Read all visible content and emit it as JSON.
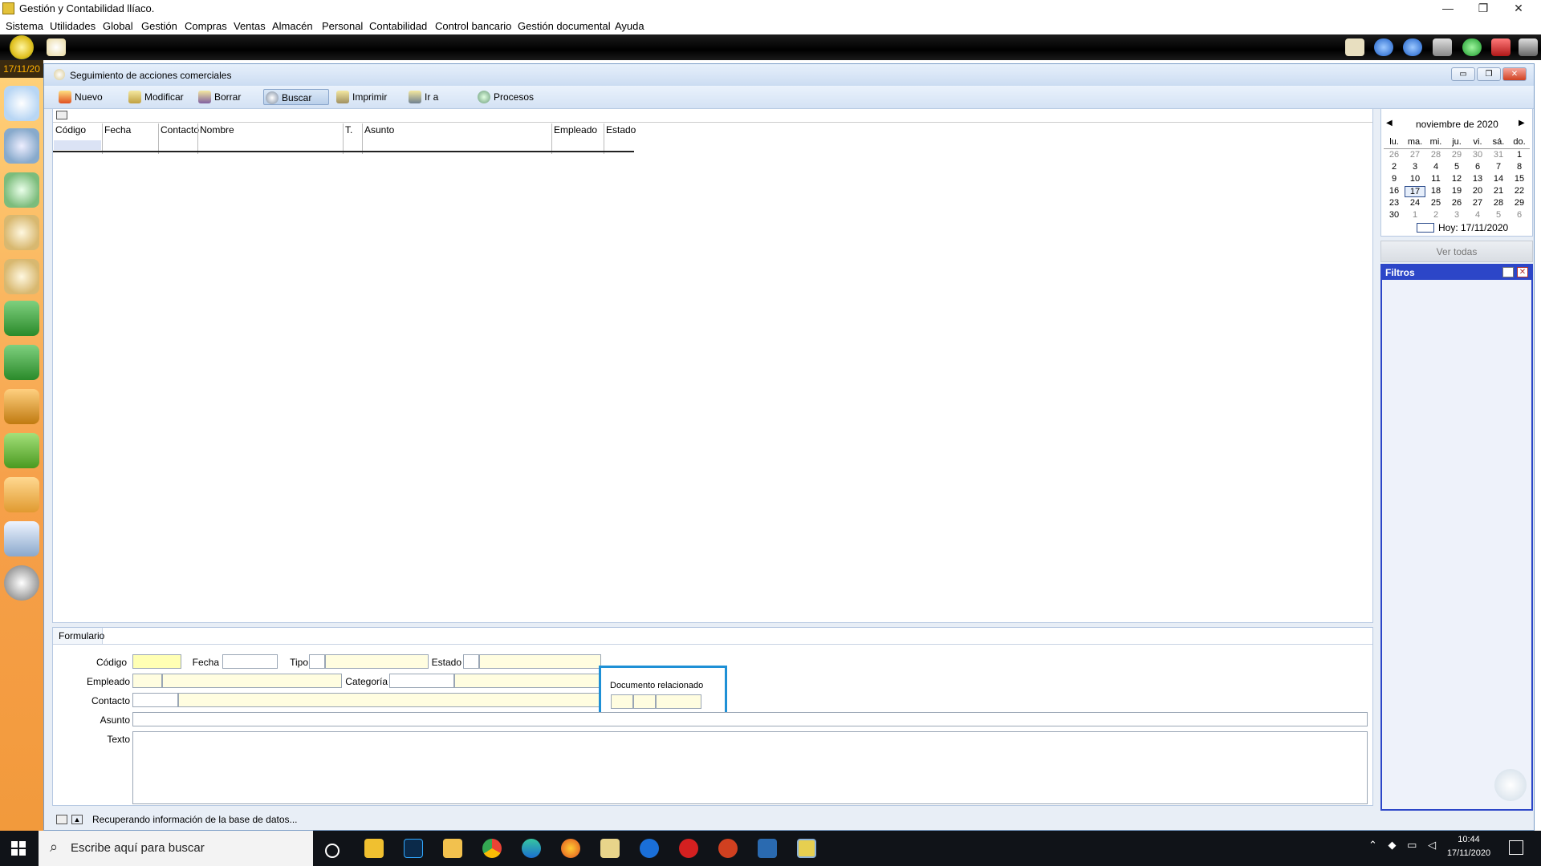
{
  "window": {
    "title": "Gestión y Contabilidad llíaco.",
    "minimize": "—",
    "restore": "❐",
    "close": "✕"
  },
  "menu": [
    "Sistema",
    "Utilidades",
    "Global",
    "Gestión",
    "Compras",
    "Ventas",
    "Almacén",
    "Personal",
    "Contabilidad",
    "Control bancario",
    "Gestión documental",
    "Ayuda"
  ],
  "sidebar": {
    "date": "17/11/20"
  },
  "child": {
    "title": "Seguimiento de acciones comerciales",
    "min": "▭",
    "restore": "❐",
    "close": "✕"
  },
  "toolbar": {
    "nuevo": "Nuevo",
    "modificar": "Modificar",
    "borrar": "Borrar",
    "buscar": "Buscar",
    "imprimir": "Imprimir",
    "ir_a": "Ir a",
    "procesos": "Procesos"
  },
  "grid": {
    "columns": [
      "Código",
      "Fecha",
      "Contacto",
      "Nombre",
      "T.",
      "Asunto",
      "Empleado",
      "Estado"
    ]
  },
  "calendar": {
    "month": "noviembre de 2020",
    "prev": "◀",
    "next": "▶",
    "weekdays": [
      "lu.",
      "ma.",
      "mi.",
      "ju.",
      "vi.",
      "sá.",
      "do."
    ],
    "weeks": [
      [
        "26",
        "27",
        "28",
        "29",
        "30",
        "31",
        "1"
      ],
      [
        "2",
        "3",
        "4",
        "5",
        "6",
        "7",
        "8"
      ],
      [
        "9",
        "10",
        "11",
        "12",
        "13",
        "14",
        "15"
      ],
      [
        "16",
        "17",
        "18",
        "19",
        "20",
        "21",
        "22"
      ],
      [
        "23",
        "24",
        "25",
        "26",
        "27",
        "28",
        "29"
      ],
      [
        "30",
        "1",
        "2",
        "3",
        "4",
        "5",
        "6"
      ]
    ],
    "today": "Hoy: 17/11/2020",
    "selected_day": "17"
  },
  "ver_todas": "Ver todas",
  "filtros": {
    "title": "Filtros"
  },
  "form": {
    "tab": "Formulario",
    "codigo": "Código",
    "fecha": "Fecha",
    "tipo": "Tipo",
    "estado": "Estado",
    "empleado": "Empleado",
    "categoria": "Categoría",
    "contacto": "Contacto",
    "asunto": "Asunto",
    "texto": "Texto",
    "documento_relacionado": "Documento relacionado"
  },
  "status": {
    "text": "Recuperando información de la base de datos..."
  },
  "taskbar": {
    "search_placeholder": "Escribe aquí para buscar",
    "time": "10:44",
    "date": "17/11/2020"
  },
  "colors": {
    "accent_blue": "#1e90d6",
    "filter_blue": "#2c46c8",
    "sidebar_orange": "#f6a04a",
    "field_yellow": "#ffffb4"
  }
}
